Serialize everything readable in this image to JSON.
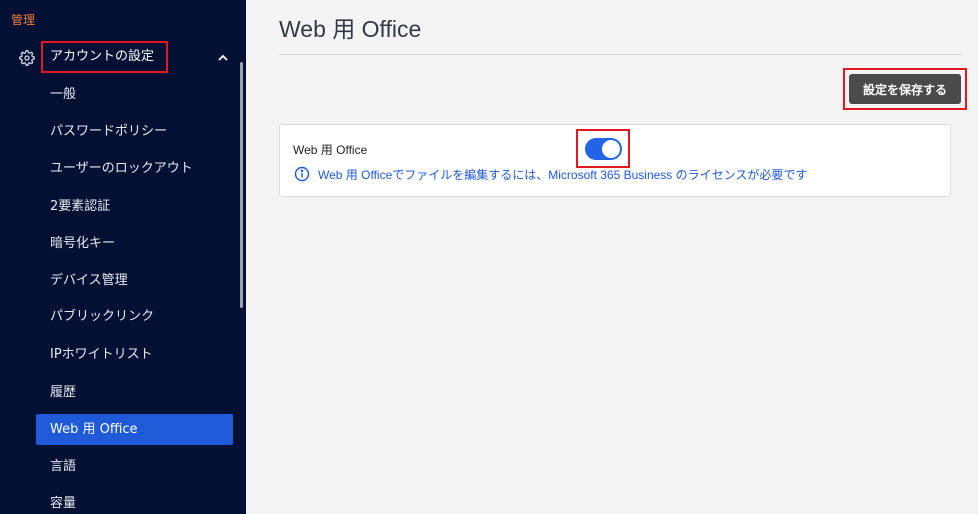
{
  "sidebar": {
    "admin_label": "管理",
    "section_title": "アカウントの設定",
    "items": [
      {
        "label": "一般",
        "active": false
      },
      {
        "label": "パスワードポリシー",
        "active": false
      },
      {
        "label": "ユーザーのロックアウト",
        "active": false
      },
      {
        "label": "2要素認証",
        "active": false
      },
      {
        "label": "暗号化キー",
        "active": false
      },
      {
        "label": "デバイス管理",
        "active": false
      },
      {
        "label": "パブリックリンク",
        "active": false
      },
      {
        "label": "IPホワイトリスト",
        "active": false
      },
      {
        "label": "履歴",
        "active": false
      },
      {
        "label": "Web 用 Office",
        "active": true
      },
      {
        "label": "言語",
        "active": false
      },
      {
        "label": "容量",
        "active": false
      }
    ]
  },
  "main": {
    "page_title": "Web 用 Office",
    "save_button_label": "設定を保存する",
    "setting": {
      "label": "Web 用 Office",
      "enabled": true,
      "info_text": "Web 用 Officeでファイルを編集するには、Microsoft 365 Business のライセンスが必要です"
    }
  },
  "colors": {
    "sidebar_bg": "#021033",
    "accent": "#1f5ad8",
    "admin_label": "#f07a3c",
    "highlight_border": "#e3171f",
    "toggle_on": "#2264e5"
  },
  "icons": {
    "section": "gear-icon",
    "collapse": "chevron-up-icon",
    "info": "info-icon"
  }
}
